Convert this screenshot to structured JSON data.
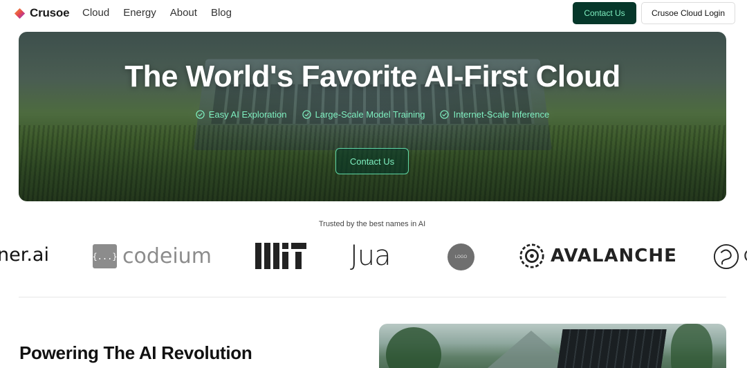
{
  "nav": {
    "brand": "Crusoe",
    "links": [
      "Cloud",
      "Energy",
      "About",
      "Blog"
    ],
    "contact_label": "Contact Us",
    "login_label": "Crusoe Cloud Login"
  },
  "hero": {
    "title": "The World's Favorite AI-First Cloud",
    "features": [
      "Easy AI Exploration",
      "Large-Scale Model Training",
      "Internet-Scale Inference"
    ],
    "cta_label": "Contact Us"
  },
  "trusted": {
    "label": "Trusted by the best names in AI",
    "logos": {
      "partial_left": "ner.ai",
      "codeium_box": "{...}",
      "codeium": "codeium",
      "jua": "Jua",
      "circle": "LOGO",
      "avalanche": "AVALANCHE",
      "partial_right": "C"
    }
  },
  "section": {
    "title": "Powering The AI Revolution"
  },
  "colors": {
    "brand_dark": "#06372a",
    "accent_mint": "#7ff0c1"
  }
}
